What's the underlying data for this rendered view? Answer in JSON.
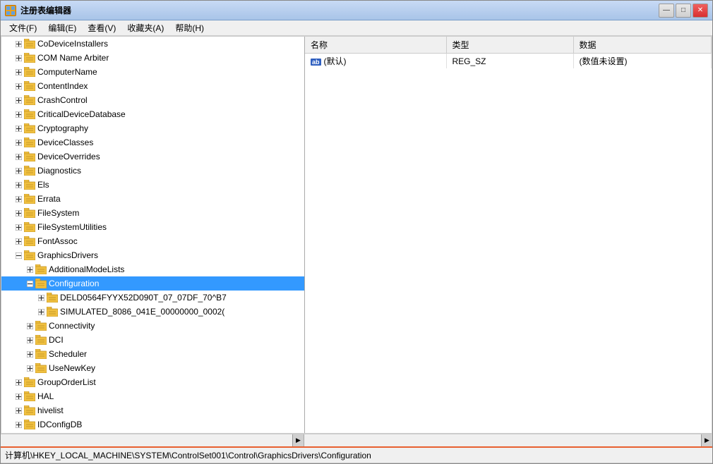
{
  "window": {
    "title": "注册表编辑器",
    "icon": "reg"
  },
  "titleButtons": {
    "minimize": "—",
    "maximize": "□",
    "close": "✕"
  },
  "menu": {
    "items": [
      {
        "id": "file",
        "label": "文件(F)"
      },
      {
        "id": "edit",
        "label": "编辑(E)"
      },
      {
        "id": "view",
        "label": "查看(V)"
      },
      {
        "id": "favorites",
        "label": "收藏夹(A)"
      },
      {
        "id": "help",
        "label": "帮助(H)"
      }
    ]
  },
  "treeItems": [
    {
      "id": "codeviceinstallers",
      "label": "CoDeviceInstallers",
      "indent": 1,
      "expanded": false,
      "hasChildren": true
    },
    {
      "id": "comname",
      "label": "COM Name Arbiter",
      "indent": 1,
      "expanded": false,
      "hasChildren": true
    },
    {
      "id": "computername",
      "label": "ComputerName",
      "indent": 1,
      "expanded": false,
      "hasChildren": true
    },
    {
      "id": "contentindex",
      "label": "ContentIndex",
      "indent": 1,
      "expanded": false,
      "hasChildren": true
    },
    {
      "id": "crashcontrol",
      "label": "CrashControl",
      "indent": 1,
      "expanded": false,
      "hasChildren": true
    },
    {
      "id": "criticaldevicedatabase",
      "label": "CriticalDeviceDatabase",
      "indent": 1,
      "expanded": false,
      "hasChildren": true
    },
    {
      "id": "cryptography",
      "label": "Cryptography",
      "indent": 1,
      "expanded": false,
      "hasChildren": true
    },
    {
      "id": "deviceclasses",
      "label": "DeviceClasses",
      "indent": 1,
      "expanded": false,
      "hasChildren": true
    },
    {
      "id": "deviceoverrides",
      "label": "DeviceOverrides",
      "indent": 1,
      "expanded": false,
      "hasChildren": true
    },
    {
      "id": "diagnostics",
      "label": "Diagnostics",
      "indent": 1,
      "expanded": false,
      "hasChildren": true
    },
    {
      "id": "els",
      "label": "Els",
      "indent": 1,
      "expanded": false,
      "hasChildren": true
    },
    {
      "id": "errata",
      "label": "Errata",
      "indent": 1,
      "expanded": false,
      "hasChildren": true
    },
    {
      "id": "filesystem",
      "label": "FileSystem",
      "indent": 1,
      "expanded": false,
      "hasChildren": true
    },
    {
      "id": "filesystemutilities",
      "label": "FileSystemUtilities",
      "indent": 1,
      "expanded": false,
      "hasChildren": true
    },
    {
      "id": "fontassoc",
      "label": "FontAssoc",
      "indent": 1,
      "expanded": false,
      "hasChildren": true
    },
    {
      "id": "graphicsdrivers",
      "label": "GraphicsDrivers",
      "indent": 1,
      "expanded": true,
      "hasChildren": true
    },
    {
      "id": "additionalmodelists",
      "label": "AdditionalModeLists",
      "indent": 2,
      "expanded": false,
      "hasChildren": true
    },
    {
      "id": "configuration",
      "label": "Configuration",
      "indent": 2,
      "expanded": true,
      "hasChildren": true,
      "selected": true
    },
    {
      "id": "deld0564",
      "label": "DELD0564FYYX52D090T_07_07DF_70^B7",
      "indent": 3,
      "expanded": false,
      "hasChildren": true
    },
    {
      "id": "simulated",
      "label": "SIMULATED_8086_041E_00000000_0002(",
      "indent": 3,
      "expanded": false,
      "hasChildren": true
    },
    {
      "id": "connectivity",
      "label": "Connectivity",
      "indent": 2,
      "expanded": false,
      "hasChildren": true
    },
    {
      "id": "dci",
      "label": "DCI",
      "indent": 2,
      "expanded": false,
      "hasChildren": true
    },
    {
      "id": "scheduler",
      "label": "Scheduler",
      "indent": 2,
      "expanded": false,
      "hasChildren": true
    },
    {
      "id": "usenewkey",
      "label": "UseNewKey",
      "indent": 2,
      "expanded": false,
      "hasChildren": true
    },
    {
      "id": "grouporderlist",
      "label": "GroupOrderList",
      "indent": 1,
      "expanded": false,
      "hasChildren": true
    },
    {
      "id": "hal",
      "label": "HAL",
      "indent": 1,
      "expanded": false,
      "hasChildren": true
    },
    {
      "id": "hivelist",
      "label": "hivelist",
      "indent": 1,
      "expanded": false,
      "hasChildren": true
    },
    {
      "id": "idconfigdb",
      "label": "IDConfigDB",
      "indent": 1,
      "expanded": false,
      "hasChildren": true
    }
  ],
  "tableColumns": [
    {
      "id": "name",
      "label": "名称"
    },
    {
      "id": "type",
      "label": "类型"
    },
    {
      "id": "data",
      "label": "数据"
    }
  ],
  "tableRows": [
    {
      "name": "(默认)",
      "namePrefix": "ab",
      "type": "REG_SZ",
      "data": "(数值未设置)"
    }
  ],
  "statusBar": {
    "path": "计算机\\HKEY_LOCAL_MACHINE\\SYSTEM\\ControlSet001\\Control\\GraphicsDrivers\\Configuration"
  }
}
